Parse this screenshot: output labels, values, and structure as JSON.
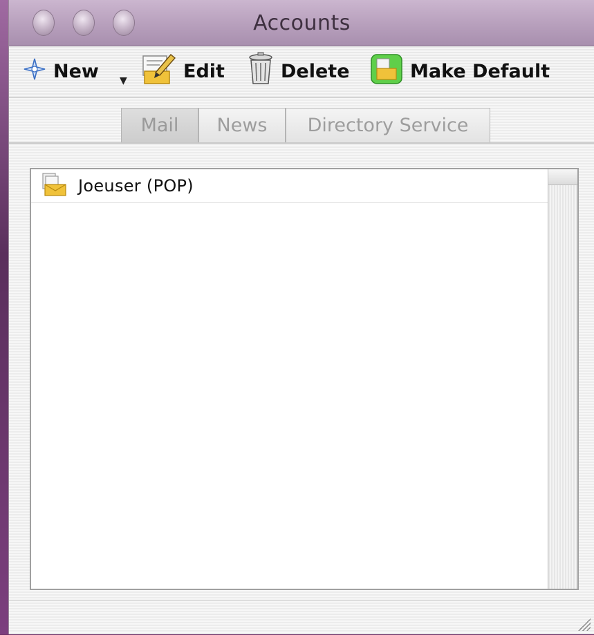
{
  "window": {
    "title": "Accounts"
  },
  "toolbar": {
    "new_label": "New",
    "edit_label": "Edit",
    "delete_label": "Delete",
    "make_default_label": "Make Default"
  },
  "tabs": [
    {
      "label": "Mail",
      "selected": true
    },
    {
      "label": "News",
      "selected": false
    },
    {
      "label": "Directory Service",
      "selected": false
    }
  ],
  "accounts": [
    {
      "name": "Joeuser (POP)",
      "icon": "mail-account-folder-icon"
    }
  ],
  "colors": {
    "titlebar": "#b9a3be",
    "desktop": "#6b2f66",
    "list_bg": "#ffffff"
  }
}
